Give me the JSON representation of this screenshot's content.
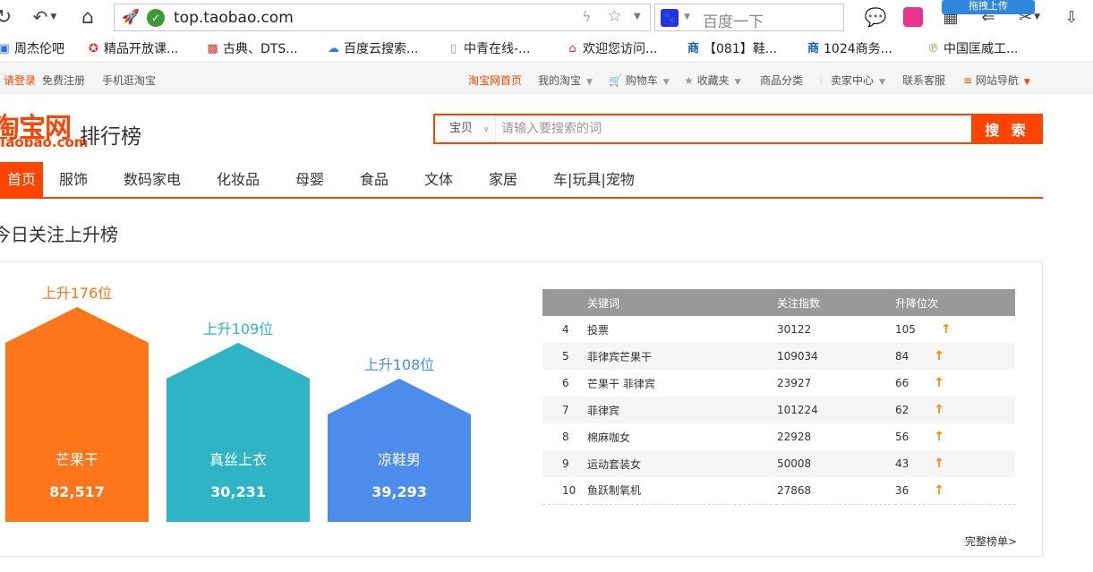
{
  "browser": {
    "url": "top.taobao.com",
    "search_placeholder": "百度一下",
    "drag_tip": "拖拽上传",
    "bookmarks": [
      {
        "label": "周杰伦吧"
      },
      {
        "label": "精品开放课..."
      },
      {
        "label": "古典、DTS..."
      },
      {
        "label": "百度云搜索..."
      },
      {
        "label": "中青在线-..."
      },
      {
        "label": "欢迎您访问..."
      },
      {
        "label": "【081】鞋..."
      },
      {
        "label": "1024商务..."
      },
      {
        "label": "中国匡威工..."
      }
    ]
  },
  "site_top": {
    "login": "请登录",
    "register": "免费注册",
    "mobile": "手机逛淘宝",
    "home": "淘宝网首页",
    "my_taobao": "我的淘宝",
    "cart": "购物车",
    "favorites": "收藏夹",
    "categories": "商品分类",
    "seller": "卖家中心",
    "service": "联系客服",
    "sitenav": "网站导航"
  },
  "header": {
    "logo_cn": "淘宝网",
    "logo_en": "Taobao.com",
    "subtitle": "排行榜",
    "search_category": "宝贝",
    "search_placeholder": "请输入要搜索的词",
    "search_button": "搜 索"
  },
  "nav": [
    "首页",
    "服饰",
    "数码家电",
    "化妆品",
    "母婴",
    "食品",
    "文体",
    "家居",
    "车|玩具|宠物"
  ],
  "section_title": "今日关注上升榜",
  "colors": {
    "brand": "#ff4400",
    "bar1": "#ff7519",
    "bar2": "#2eb5c5",
    "bar3": "#4c8deb"
  },
  "top3": [
    {
      "rise": "上升176位",
      "name": "芒果干",
      "value": "82,517",
      "color": "#ff7519",
      "label_color": "#ff7519"
    },
    {
      "rise": "上升109位",
      "name": "真丝上衣",
      "value": "30,231",
      "color": "#2eb5c5",
      "label_color": "#2eb5c5"
    },
    {
      "rise": "上升108位",
      "name": "凉鞋男",
      "value": "39,293",
      "color": "#4c8deb",
      "label_color": "#4c8deb"
    }
  ],
  "table": {
    "headers": [
      "关键词",
      "关注指数",
      "升降位次"
    ],
    "rows": [
      {
        "rank": "4",
        "keyword": "投票",
        "index": "30122",
        "change": "105"
      },
      {
        "rank": "5",
        "keyword": "菲律宾芒果干",
        "index": "109034",
        "change": "84"
      },
      {
        "rank": "6",
        "keyword": "芒果干 菲律宾",
        "index": "23927",
        "change": "66"
      },
      {
        "rank": "7",
        "keyword": "菲律宾",
        "index": "101224",
        "change": "62"
      },
      {
        "rank": "8",
        "keyword": "棉麻咖女",
        "index": "22928",
        "change": "56"
      },
      {
        "rank": "9",
        "keyword": "运动套装女",
        "index": "50008",
        "change": "43"
      },
      {
        "rank": "10",
        "keyword": "鱼跃制氧机",
        "index": "27868",
        "change": "36"
      }
    ]
  },
  "more_link": "完整榜单>"
}
